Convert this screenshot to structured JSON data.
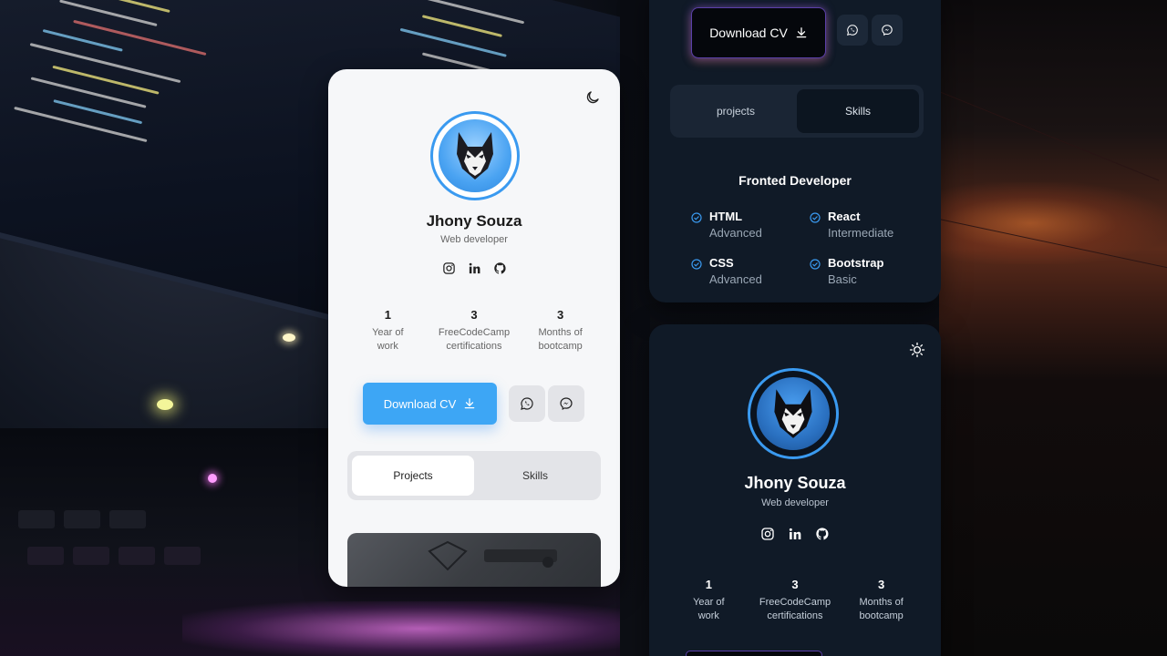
{
  "colors": {
    "accent_blue": "#3da6f5",
    "dark_card": "#101a27",
    "light_card": "#f6f7f9",
    "check_blue": "#3a9af0"
  },
  "light_card": {
    "theme_icon": "moon-icon",
    "avatar_icon": "husky-icon",
    "name": "Jhony Souza",
    "role": "Web developer",
    "socials": [
      "instagram-icon",
      "linkedin-icon",
      "github-icon"
    ],
    "stats": [
      {
        "value": "1",
        "label_1": "Year of",
        "label_2": "work"
      },
      {
        "value": "3",
        "label_1": "FreeCodeCamp",
        "label_2": "certifications"
      },
      {
        "value": "3",
        "label_1": "Months of",
        "label_2": "bootcamp"
      }
    ],
    "download_label": "Download CV",
    "tabs": [
      "Projects",
      "Skills"
    ],
    "active_tab": "Projects"
  },
  "dark_card_top": {
    "download_label": "Download CV",
    "tabs": [
      "projects",
      "Skills"
    ],
    "active_tab": "Skills",
    "skills_title": "Fronted Developer",
    "skills": [
      {
        "name": "HTML",
        "level": "Advanced"
      },
      {
        "name": "React",
        "level": "Intermediate"
      },
      {
        "name": "CSS",
        "level": "Advanced"
      },
      {
        "name": "Bootstrap",
        "level": "Basic"
      }
    ]
  },
  "dark_card_bottom": {
    "theme_icon": "sun-icon",
    "avatar_icon": "husky-icon",
    "name": "Jhony Souza",
    "role": "Web developer",
    "socials": [
      "instagram-icon",
      "linkedin-icon",
      "github-icon"
    ],
    "stats": [
      {
        "value": "1",
        "label_1": "Year of",
        "label_2": "work"
      },
      {
        "value": "3",
        "label_1": "FreeCodeCamp",
        "label_2": "certifications"
      },
      {
        "value": "3",
        "label_1": "Months of",
        "label_2": "bootcamp"
      }
    ]
  }
}
